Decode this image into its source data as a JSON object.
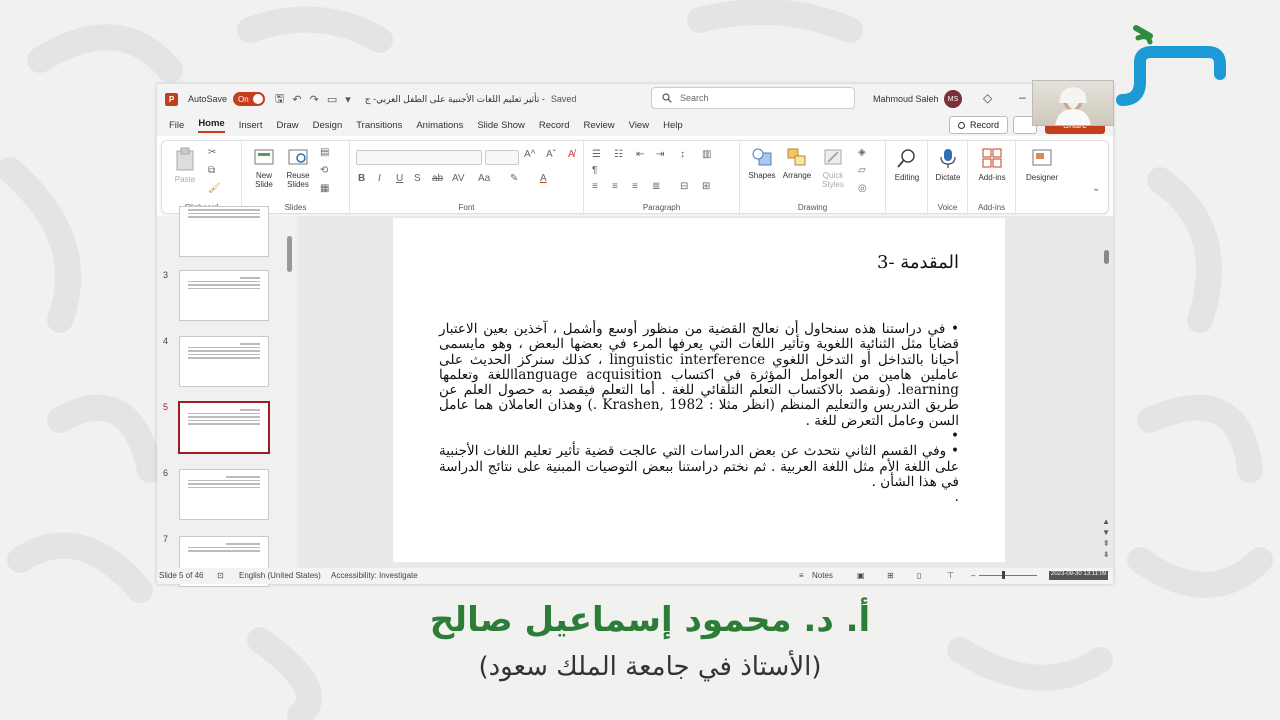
{
  "app": {
    "autosave_label": "AutoSave",
    "autosave_state": "On",
    "doc_title": "تأثير تعليم اللغات الأجنبية على الطفل العربي- ج -",
    "saved_status": "Saved",
    "search_placeholder": "Search",
    "user_name": "Mahmoud Saleh",
    "user_initials": "MS"
  },
  "menu": {
    "tabs": [
      "File",
      "Home",
      "Insert",
      "Draw",
      "Design",
      "Transitions",
      "Animations",
      "Slide Show",
      "Record",
      "Review",
      "View",
      "Help"
    ],
    "active": "Home",
    "record_label": "Record",
    "share_label": "Share"
  },
  "ribbon": {
    "clipboard": {
      "paste": "Paste",
      "label": "Clipboard"
    },
    "slides": {
      "new_slide": "New Slide",
      "reuse_slides": "Reuse Slides",
      "label": "Slides"
    },
    "font": {
      "label": "Font"
    },
    "paragraph": {
      "label": "Paragraph"
    },
    "drawing": {
      "shapes": "Shapes",
      "arrange": "Arrange",
      "quick_styles": "Quick Styles",
      "label": "Drawing"
    },
    "editing": {
      "label": "Editing"
    },
    "voice": {
      "dictate": "Dictate",
      "label": "Voice"
    },
    "addins": {
      "addins": "Add-ins",
      "label": "Add-ins"
    },
    "designer": {
      "label": "Designer"
    }
  },
  "thumbnails": {
    "numbers": [
      "3",
      "4",
      "5",
      "6",
      "7"
    ],
    "active": "5"
  },
  "slide": {
    "title": "المقدمة -3",
    "paragraphs": [
      "• في دراستنا هذه سنحاول أن نعالج القضية من منظور أوسع وأشمل ، آخذين بعين الاعتبار قضايا مثل الثنائية اللغوية وتأثير اللغات التي يعرفها المرء في بعضها البعض ، وهو مايسمى أحيانا بالتداخل أو التدخل اللغوي linguistic interference ، كذلك سنركز الحديث على عاملين هامين من العوامل المؤثرة في اكتساب language acquisitionاللغة وتعلمها learning. (ونقصد بالاكتساب التعلم التلقائي للغة . أما التعلم فيقصد به حصول العلم عن طريق التدريس والتعليم المنظم (انظر مثلا : Krashen, 1982 .) وهذان العاملان هما عامل السن وعامل التعرض للغة .",
      "•",
      "• وفي القسم الثاني نتحدث عن بعض الدراسات التي عالجت قضية تأثير تعليم اللغات الأجنبية على اللغة الأم مثل اللغة العربية . ثم نختم دراستنا ببعض التوصيات المبنية على نتائج الدراسة في هذا الشأن .",
      "."
    ]
  },
  "status": {
    "slide_count": "Slide 5 of 46",
    "language": "English (United States)",
    "accessibility": "Accessibility: Investigate",
    "notes": "Notes",
    "datestamp": "2023-09-30 13:11:09"
  },
  "caption": {
    "name": "أ. د. محمود إسماعيل صالح",
    "title": "(الأستاذ في جامعة الملك سعود)"
  },
  "colors": {
    "accent": "#c43e1c",
    "caption_green": "#2c7d37",
    "logo_blue": "#1d9ad6",
    "logo_green": "#2f8b3e"
  }
}
